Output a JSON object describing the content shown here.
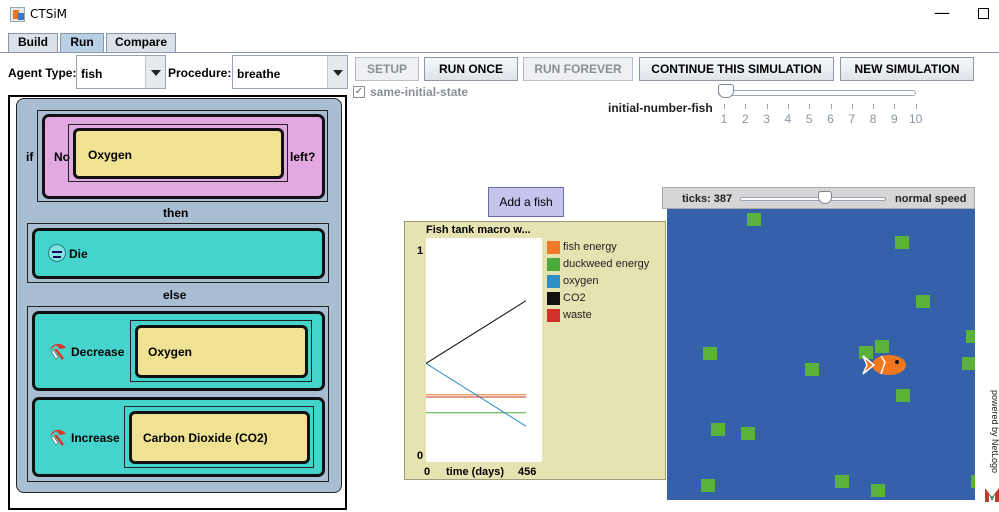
{
  "window": {
    "title": "CTSiM",
    "minimize_glyph": "—",
    "maximize_glyph": ""
  },
  "tabs": [
    {
      "label": "Build",
      "active": false
    },
    {
      "label": "Run",
      "active": true
    },
    {
      "label": "Compare",
      "active": false
    }
  ],
  "agent": {
    "label": "Agent Type:",
    "value": "fish"
  },
  "procedure": {
    "label": "Procedure:",
    "value": "breathe"
  },
  "buttons": {
    "setup": "SETUP",
    "run_once": "RUN ONCE",
    "run_forever": "RUN FOREVER",
    "continue": "CONTINUE THIS SIMULATION",
    "new_sim": "NEW SIMULATION"
  },
  "checkbox": {
    "label": "same-initial-state",
    "checked": true
  },
  "initial_fish_slider": {
    "label": "initial-number-fish",
    "value": 1,
    "ticks": [
      "1",
      "2",
      "3",
      "4",
      "5",
      "6",
      "7",
      "8",
      "9",
      "10"
    ]
  },
  "code": {
    "if_label": "if",
    "condition_left": "No",
    "condition_value": "Oxygen",
    "condition_right": "left?",
    "then_label": "then",
    "then_action": "Die",
    "else_label": "else",
    "else_actions": [
      {
        "verb": "Decrease",
        "target": "Oxygen"
      },
      {
        "verb": "Increase",
        "target": "Carbon Dioxide (CO2)"
      }
    ]
  },
  "add_fish_button": "Add a fish",
  "plot": {
    "title": "Fish tank macro w...",
    "y_max_label": "1",
    "y_min_label": "0",
    "x_min_label": "0",
    "x_label": "time (days)",
    "x_max_label": "456",
    "legend": [
      {
        "name": "fish energy",
        "color": "#f07a2a"
      },
      {
        "name": "duckweed energy",
        "color": "#4caa3c"
      },
      {
        "name": "oxygen",
        "color": "#2d8fc4"
      },
      {
        "name": "CO2",
        "color": "#111111"
      },
      {
        "name": "waste",
        "color": "#d2302a"
      }
    ]
  },
  "chart_data": {
    "type": "line",
    "title": "Fish tank macro w...",
    "xlabel": "time (days)",
    "ylabel": "",
    "xlim": [
      0,
      456
    ],
    "ylim": [
      0,
      1
    ],
    "series": [
      {
        "name": "fish energy",
        "x": [
          0,
          456
        ],
        "values": [
          0.3,
          0.3
        ]
      },
      {
        "name": "duckweed energy",
        "x": [
          0,
          456
        ],
        "values": [
          0.22,
          0.22
        ]
      },
      {
        "name": "oxygen",
        "x": [
          0,
          456
        ],
        "values": [
          0.44,
          0.16
        ]
      },
      {
        "name": "CO2",
        "x": [
          0,
          456
        ],
        "values": [
          0.44,
          0.72
        ]
      },
      {
        "name": "waste",
        "x": [
          0,
          456
        ],
        "values": [
          0.29,
          0.29
        ]
      }
    ]
  },
  "world": {
    "ticks_label": "ticks: 387",
    "speed_label": "normal speed",
    "speed_value": 0.58,
    "powered_by": "powered by NetLogo",
    "background_color": "#3461a9",
    "duckweed_color": "#5ab23a"
  }
}
